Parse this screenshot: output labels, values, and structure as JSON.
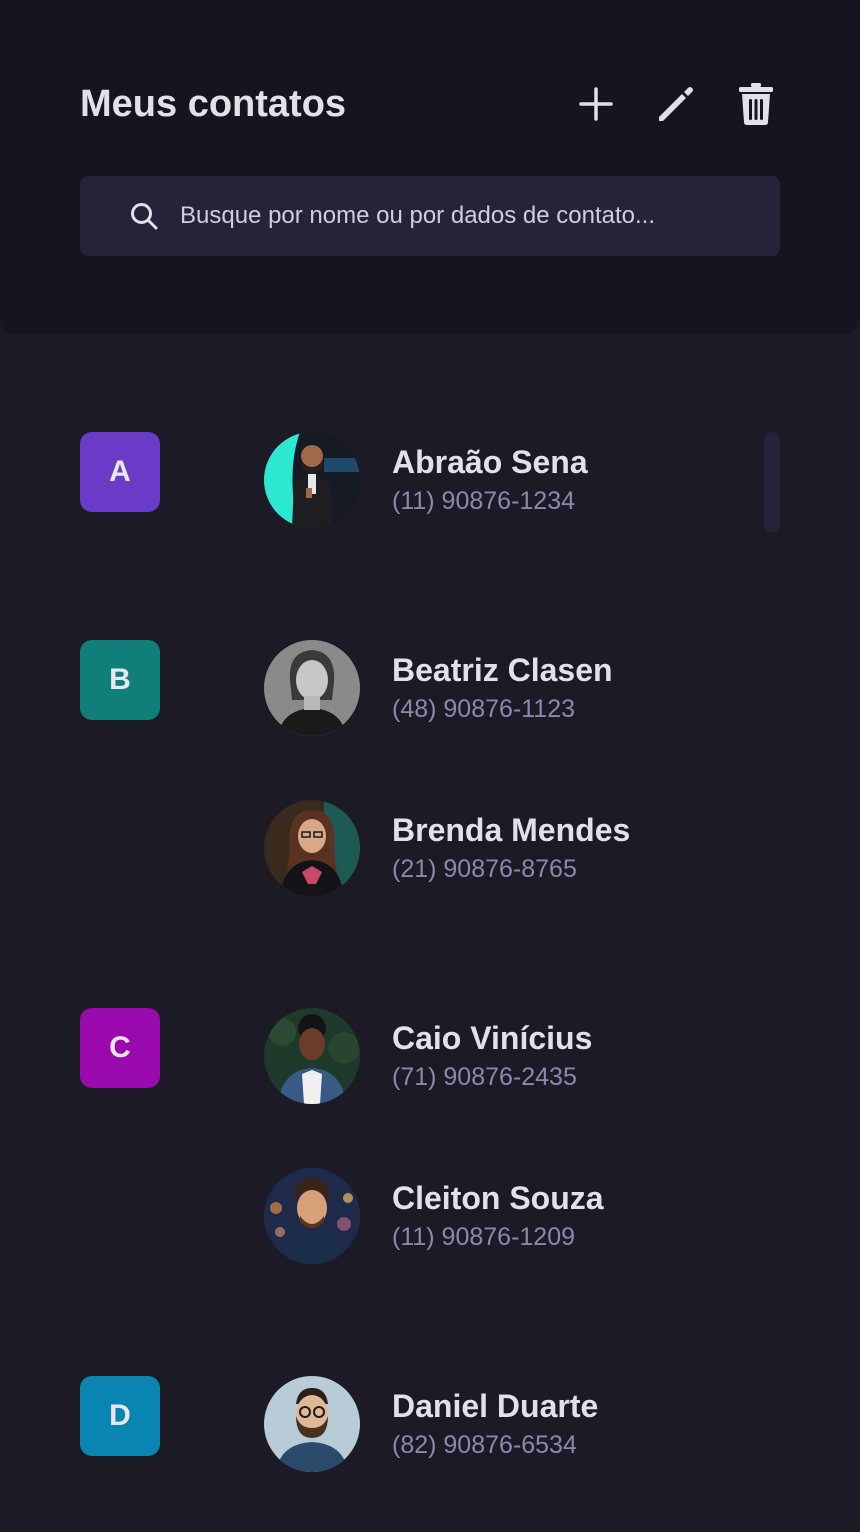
{
  "header": {
    "title": "Meus contatos",
    "add_icon": "plus-icon",
    "edit_icon": "pencil-icon",
    "delete_icon": "trash-icon"
  },
  "search": {
    "icon": "search-icon",
    "placeholder": "Busque por nome ou por dados de contato..."
  },
  "groups": [
    {
      "letter": "A",
      "color": "#6a3bc6",
      "contacts": [
        {
          "name": "Abraão Sena",
          "phone": "(11) 90876-1234",
          "avatar": "photo-man-on-stage"
        }
      ]
    },
    {
      "letter": "B",
      "color": "#117f79",
      "contacts": [
        {
          "name": "Beatriz Clasen",
          "phone": "(48) 90876-1123",
          "avatar": "photo-woman-grayscale"
        },
        {
          "name": "Brenda Mendes",
          "phone": "(21) 90876-8765",
          "avatar": "photo-woman-glasses"
        }
      ]
    },
    {
      "letter": "C",
      "color": "#9a09ad",
      "contacts": [
        {
          "name": "Caio Vinícius",
          "phone": "(71) 90876-2435",
          "avatar": "photo-man-denim-jacket"
        },
        {
          "name": "Cleiton Souza",
          "phone": "(11) 90876-1209",
          "avatar": "photo-man-city-lights"
        }
      ]
    },
    {
      "letter": "D",
      "color": "#0a85b2",
      "contacts": [
        {
          "name": "Daniel Duarte",
          "phone": "(82) 90876-6534",
          "avatar": "photo-man-beard-glasses"
        }
      ]
    }
  ],
  "colors": {
    "background": "#1c1a25",
    "header_bg": "#16151f",
    "search_bg": "#24233a",
    "text": "#e2e1e8",
    "phone_text": "#8a88ad"
  }
}
